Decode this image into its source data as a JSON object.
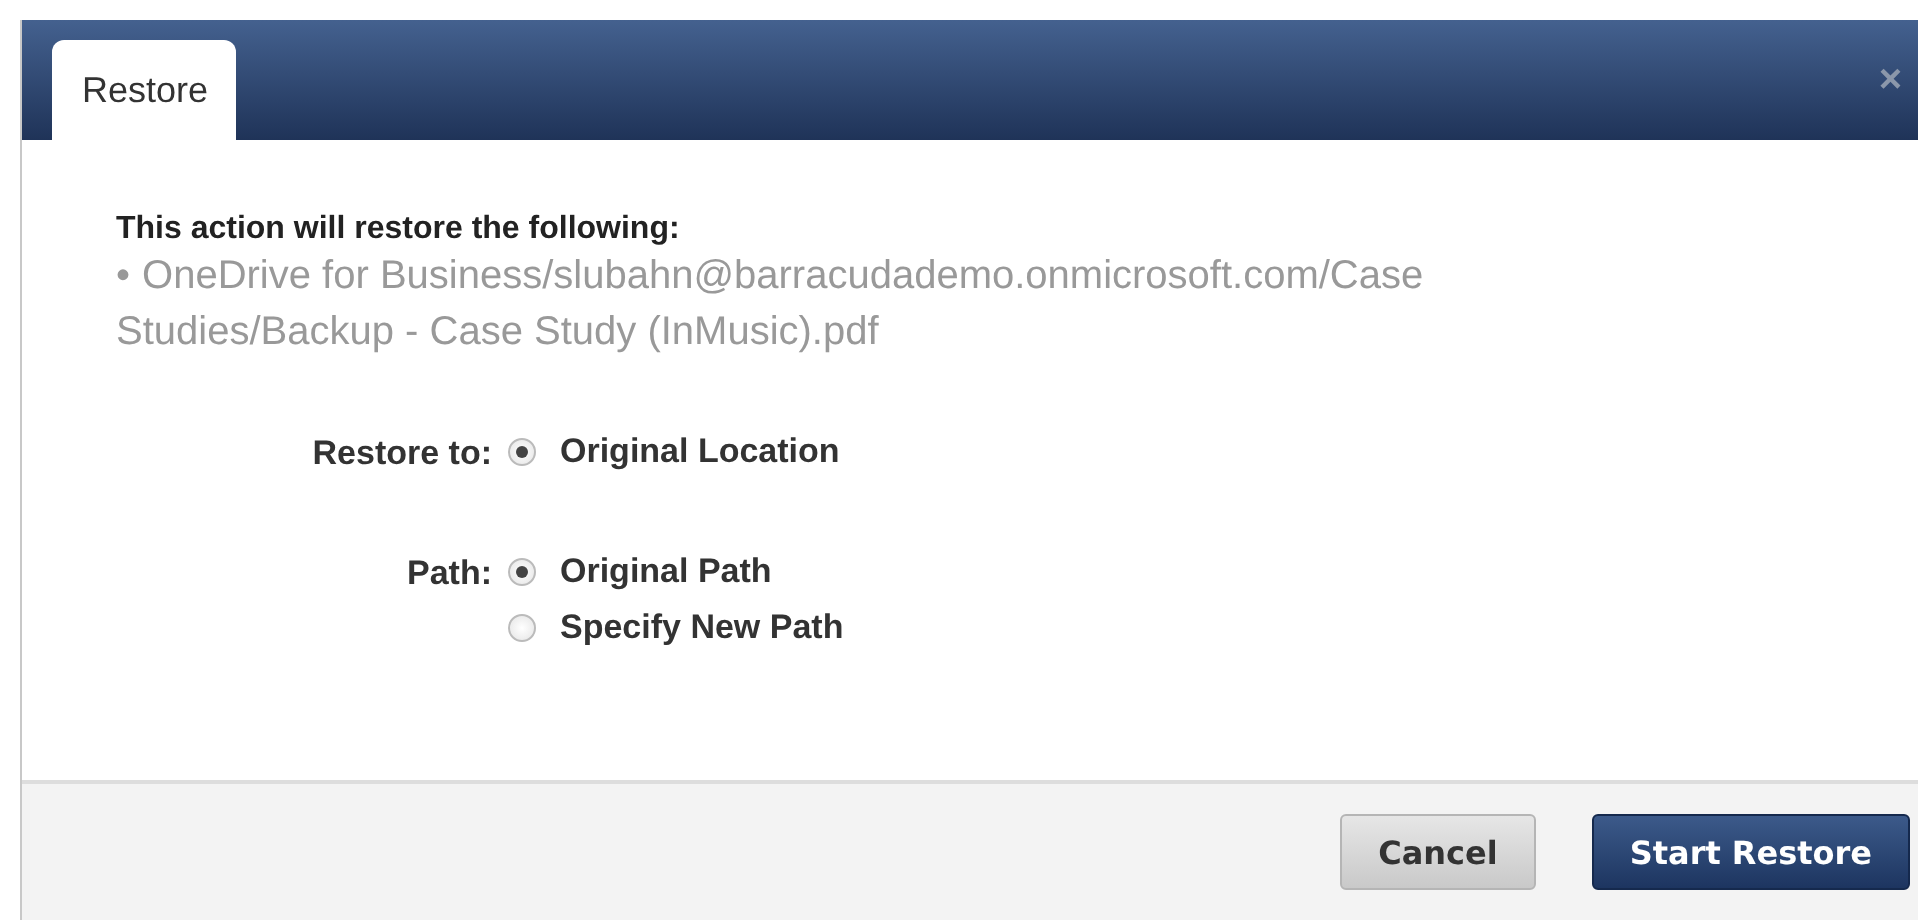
{
  "dialog": {
    "tab": "Restore",
    "close": "×"
  },
  "summary": {
    "heading": "This action will restore the following:",
    "bullet": "•",
    "items": [
      "OneDrive for Business/slubahn@barracudademo.onmicrosoft.com/Case Studies/Backup - Case Study (InMusic).pdf"
    ]
  },
  "options": [
    {
      "label": "Restore to:",
      "choices": [
        {
          "label": "Original Location",
          "selected": true
        }
      ]
    },
    {
      "label": "Path:",
      "choices": [
        {
          "label": "Original Path",
          "selected": true
        },
        {
          "label": "Specify New Path",
          "selected": false
        }
      ]
    }
  ],
  "buttons": [
    {
      "label": "Cancel",
      "kind": "secondary"
    },
    {
      "label": "Start Restore",
      "kind": "primary"
    }
  ]
}
